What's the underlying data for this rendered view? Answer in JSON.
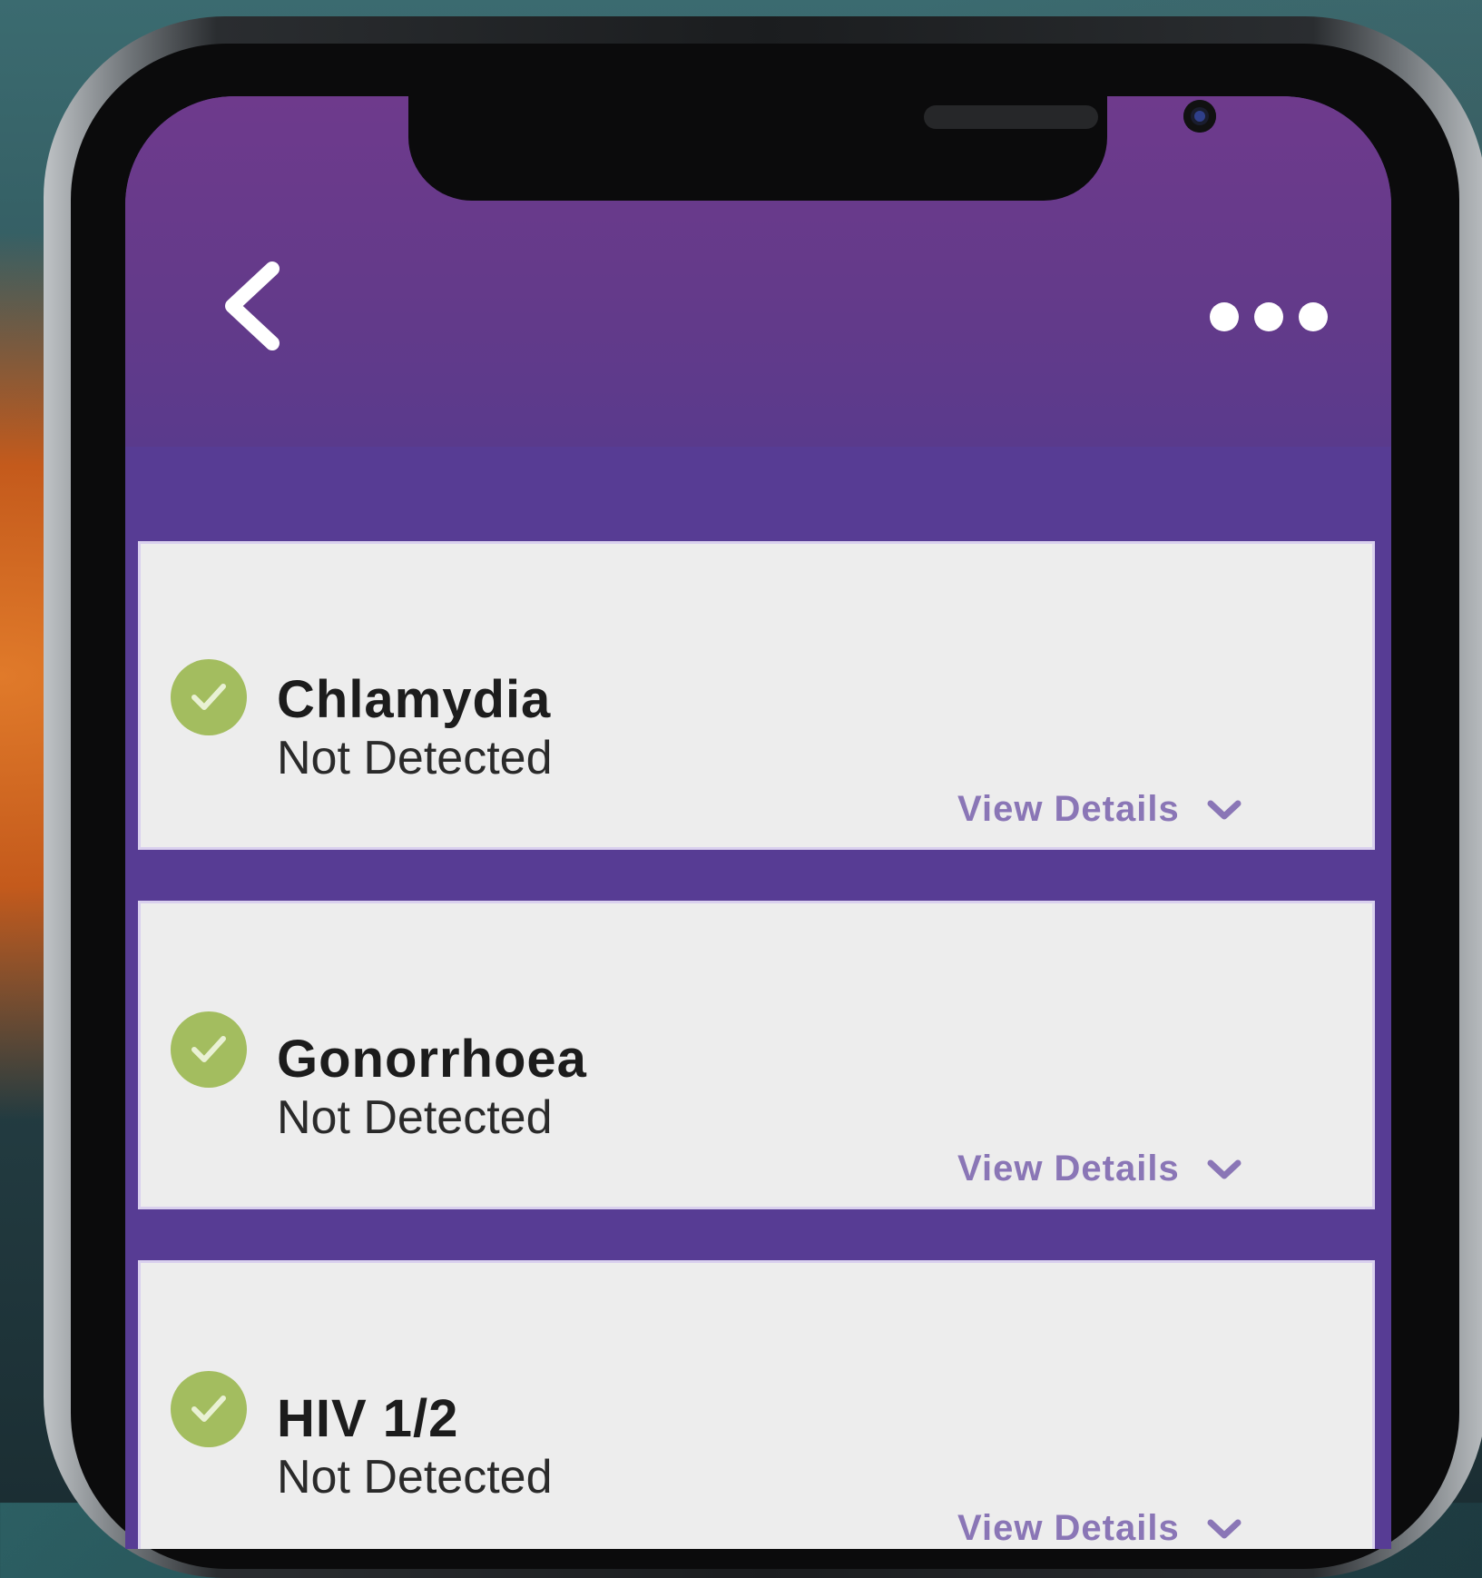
{
  "header": {
    "back_icon": "chevron-left-icon",
    "more_icon": "more-horizontal-icon",
    "background_color": "#663a8b"
  },
  "results": [
    {
      "name": "Chlamydia",
      "status": "Not Detected",
      "details_label": "View Details",
      "icon": "check-circle-icon"
    },
    {
      "name": "Gonorrhoea",
      "status": "Not Detected",
      "details_label": "View Details",
      "icon": "check-circle-icon"
    },
    {
      "name": "HIV 1/2",
      "status": "Not Detected",
      "details_label": "View Details",
      "icon": "check-circle-icon"
    }
  ],
  "colors": {
    "accent_purple": "#573c94",
    "check_green": "#a3bd5f",
    "details_text": "#8a76b6"
  }
}
